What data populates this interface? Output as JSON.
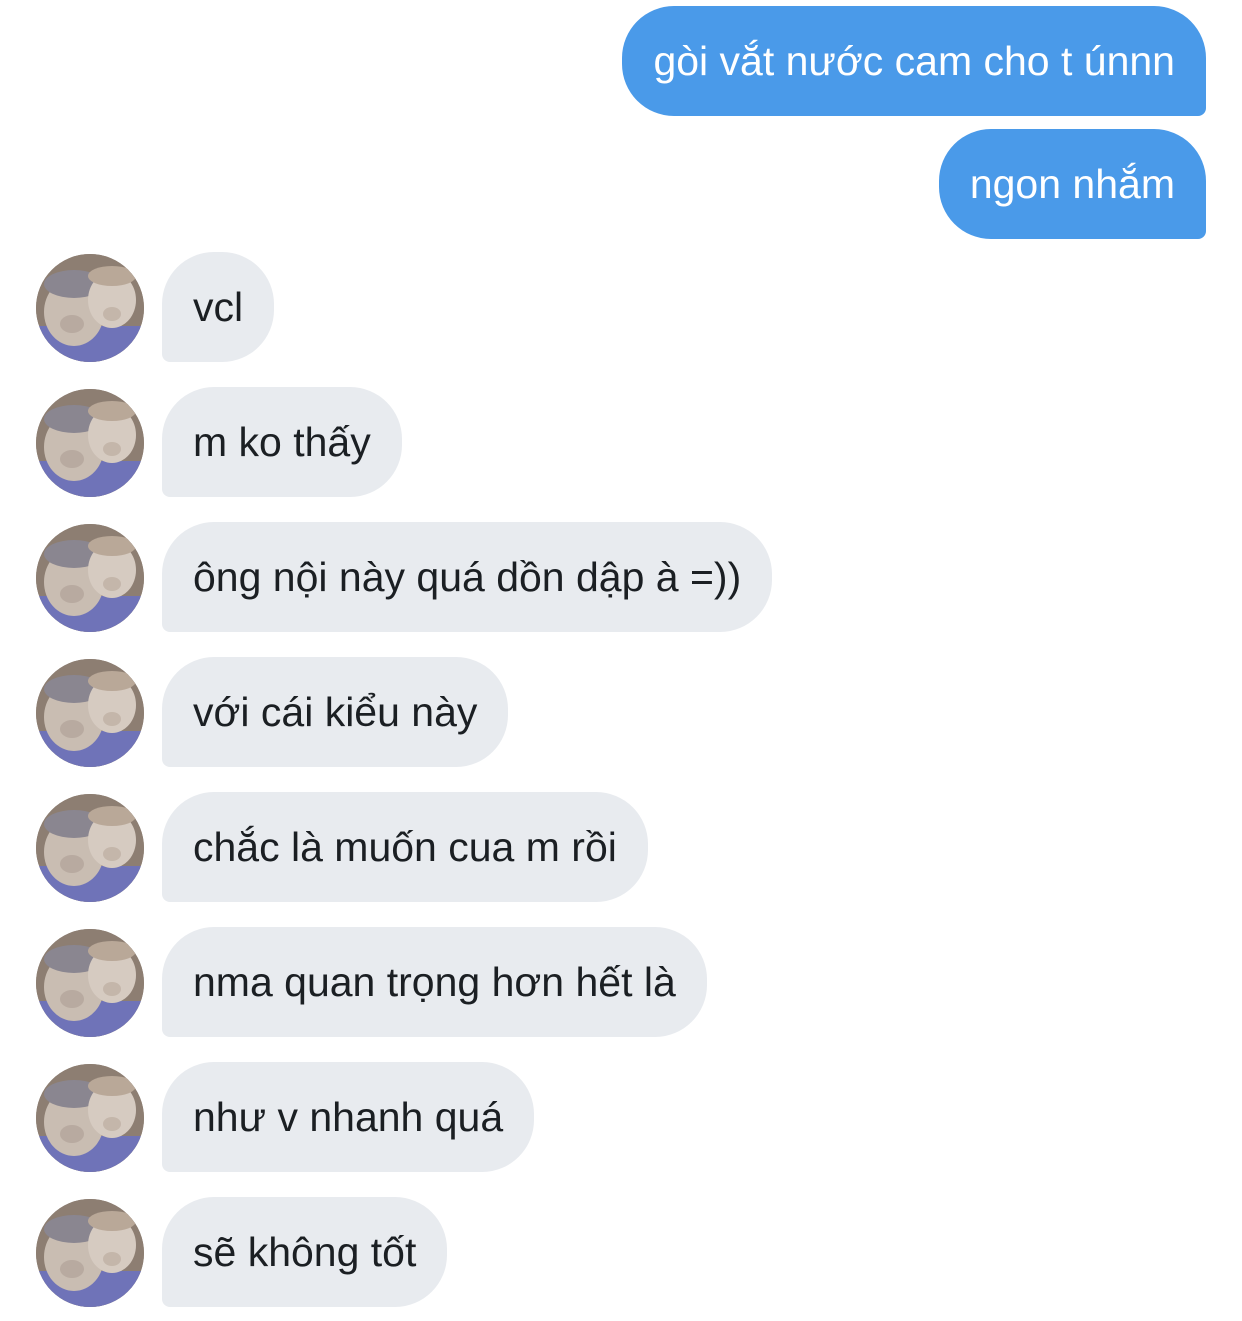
{
  "colors": {
    "outgoing_bubble": "#4a9ae9",
    "incoming_bubble": "#e8ebef",
    "incoming_text": "#1b1f23",
    "background": "#ffffff"
  },
  "messages": [
    {
      "direction": "outgoing",
      "text": "gòi vắt nước cam cho t únnn"
    },
    {
      "direction": "outgoing",
      "text": "ngon nhắm"
    },
    {
      "direction": "incoming",
      "text": "vcl",
      "avatar": "user-avatar-photo"
    },
    {
      "direction": "incoming",
      "text": "m ko thấy",
      "avatar": "user-avatar-photo"
    },
    {
      "direction": "incoming",
      "text": "ông nội này quá dồn dập à =))",
      "avatar": "user-avatar-photo"
    },
    {
      "direction": "incoming",
      "text": "với cái kiểu này",
      "avatar": "user-avatar-photo"
    },
    {
      "direction": "incoming",
      "text": "chắc là muốn cua m rồi",
      "avatar": "user-avatar-photo"
    },
    {
      "direction": "incoming",
      "text": "nma quan trọng hơn hết là",
      "avatar": "user-avatar-photo"
    },
    {
      "direction": "incoming",
      "text": "như v nhanh quá",
      "avatar": "user-avatar-photo"
    },
    {
      "direction": "incoming",
      "text": "sẽ không tốt",
      "avatar": "user-avatar-photo"
    }
  ]
}
